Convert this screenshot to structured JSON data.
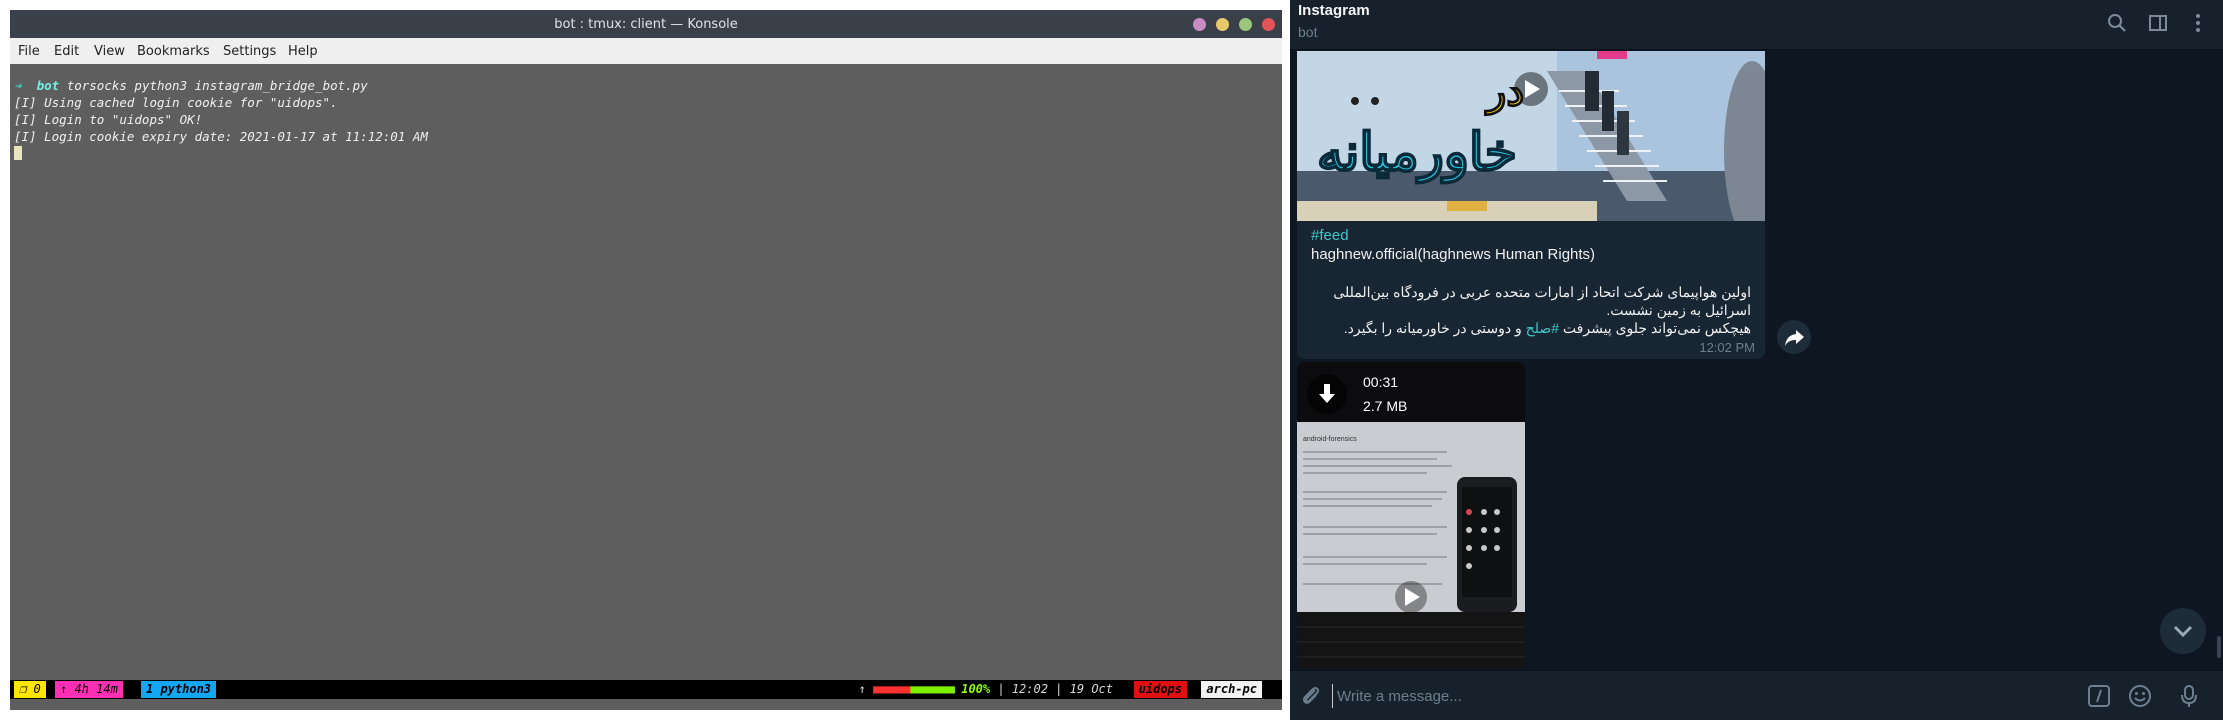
{
  "konsole": {
    "title": "bot : tmux: client — Konsole",
    "menu": [
      "File",
      "Edit",
      "View",
      "Bookmarks",
      "Settings",
      "Help"
    ],
    "terminal": {
      "prompt_arrow": "➔",
      "prompt_dir": "bot",
      "command": "torsocks python3 instagram_bridge_bot.py",
      "lines": [
        "[I] Using cached login cookie for \"uidops\".",
        "[I] Login to \"uidops\" OK!",
        "[I] Login cookie expiry date: 2021-01-17 at 11:12:01 AM"
      ]
    },
    "tmux": {
      "window": "❐ 0",
      "uptime": "↑ 4h 14m",
      "tab": "1 python3",
      "battery_arrow": "↑",
      "battery_pct": "100%",
      "time": "12:02",
      "date": "19 Oct",
      "user": "uidops",
      "host": "arch-pc"
    }
  },
  "telegram": {
    "chat_title": "Instagram",
    "chat_subtitle": "bot",
    "message1": {
      "thumb_text_top": "در",
      "thumb_text": "خاورمیانه",
      "hashtag": "#feed",
      "channel": "haghnew.official(haghnews Human Rights)",
      "line1": "اولین هواپیمای شرکت اتحاد از امارات متحده عربی در فرودگاه بین‌المللی",
      "line2": "اسرائیل به زمین نشست.",
      "line3_pre": "هیچکس نمی‌تواند جلوی پیشرفت ",
      "line3_tag": "#صلح",
      "line3_post": " و دوستی در خاورمیانه را بگیرد.",
      "time": "12:02 PM"
    },
    "message2": {
      "duration": "00:31",
      "size": "2.7 MB",
      "screen_title": "android-forensics"
    },
    "compose_placeholder": "Write a message...",
    "colors": {
      "background": "#0e1621",
      "bubble": "#182533",
      "accent": "#3fc9c9",
      "header": "#17212b"
    }
  }
}
